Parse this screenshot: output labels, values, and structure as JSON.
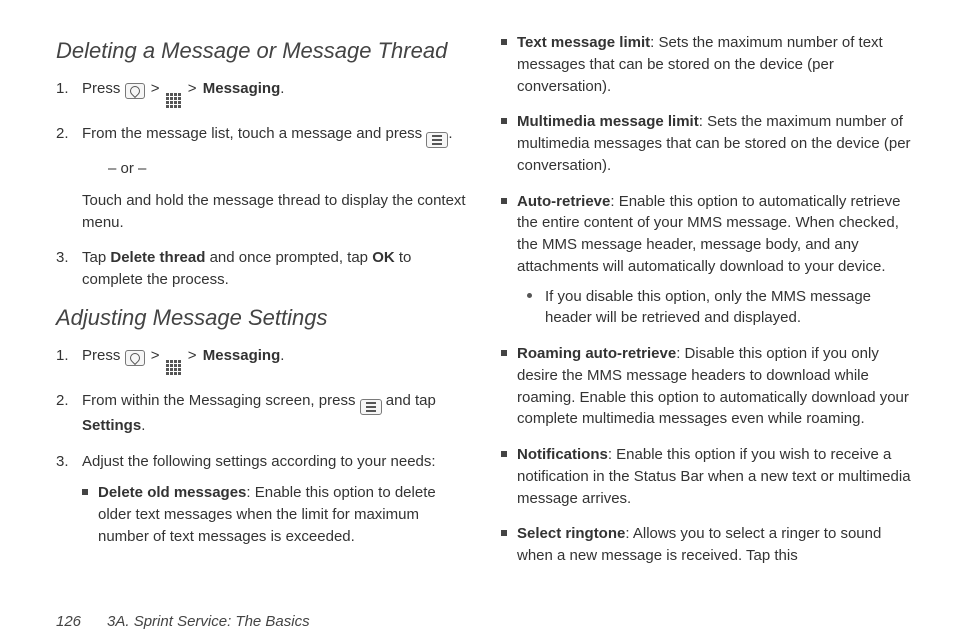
{
  "page_number": "126",
  "footer_title": "3A. Sprint Service: The Basics",
  "glyph": {
    "chevron": ">"
  },
  "left": {
    "section_a": "Deleting a Message or Message Thread",
    "a1_prefix": "Press ",
    "a1_msg": "Messaging",
    "a1_period": ".",
    "a2": "From the message list, touch a message and press ",
    "a2_period": ".",
    "a2_or": "– or –",
    "a2_alt": "Touch and hold the message thread to display the context menu.",
    "a3_pre": "Tap ",
    "a3_b1": "Delete thread",
    "a3_mid": " and once prompted, tap ",
    "a3_b2": "OK",
    "a3_post": " to complete the process.",
    "section_b": "Adjusting Message Settings",
    "b1_prefix": "Press ",
    "b1_msg": "Messaging",
    "b1_period": ".",
    "b2_pre": "From within the Messaging screen, press  ",
    "b2_mid": " and tap ",
    "b2_b": "Settings",
    "b2_period": ".",
    "b3": "Adjust the following settings according to your needs:",
    "b3_bullet1_b": "Delete old messages",
    "b3_bullet1_t": ": Enable this option to delete older text messages when the limit for maximum number of text messages is exceeded."
  },
  "right": {
    "r1_b": "Text message limit",
    "r1_t": ": Sets the maximum number of text messages that can be stored on the device (per conversation).",
    "r2_b": "Multimedia message limit",
    "r2_t": ": Sets the maximum number of multimedia messages that can be stored on the device (per conversation).",
    "r3_b": "Auto-retrieve",
    "r3_t": ": Enable this option to automatically retrieve the entire content of your MMS message. When checked, the MMS message header, message body, and any attachments will automatically download to your device.",
    "r3_sub": "If you disable this option, only the MMS message header will be retrieved and displayed.",
    "r4_b": "Roaming auto-retrieve",
    "r4_t": ": Disable this option if you only desire the MMS message headers to download while roaming. Enable this option to automatically download your complete multimedia messages even while roaming.",
    "r5_b": "Notifications",
    "r5_t": ": Enable this option if you wish to receive a notification in the Status Bar when a new text or multimedia message arrives.",
    "r6_b": "Select ringtone",
    "r6_t": ": Allows you to select a ringer to sound when a new message is received. Tap this"
  }
}
